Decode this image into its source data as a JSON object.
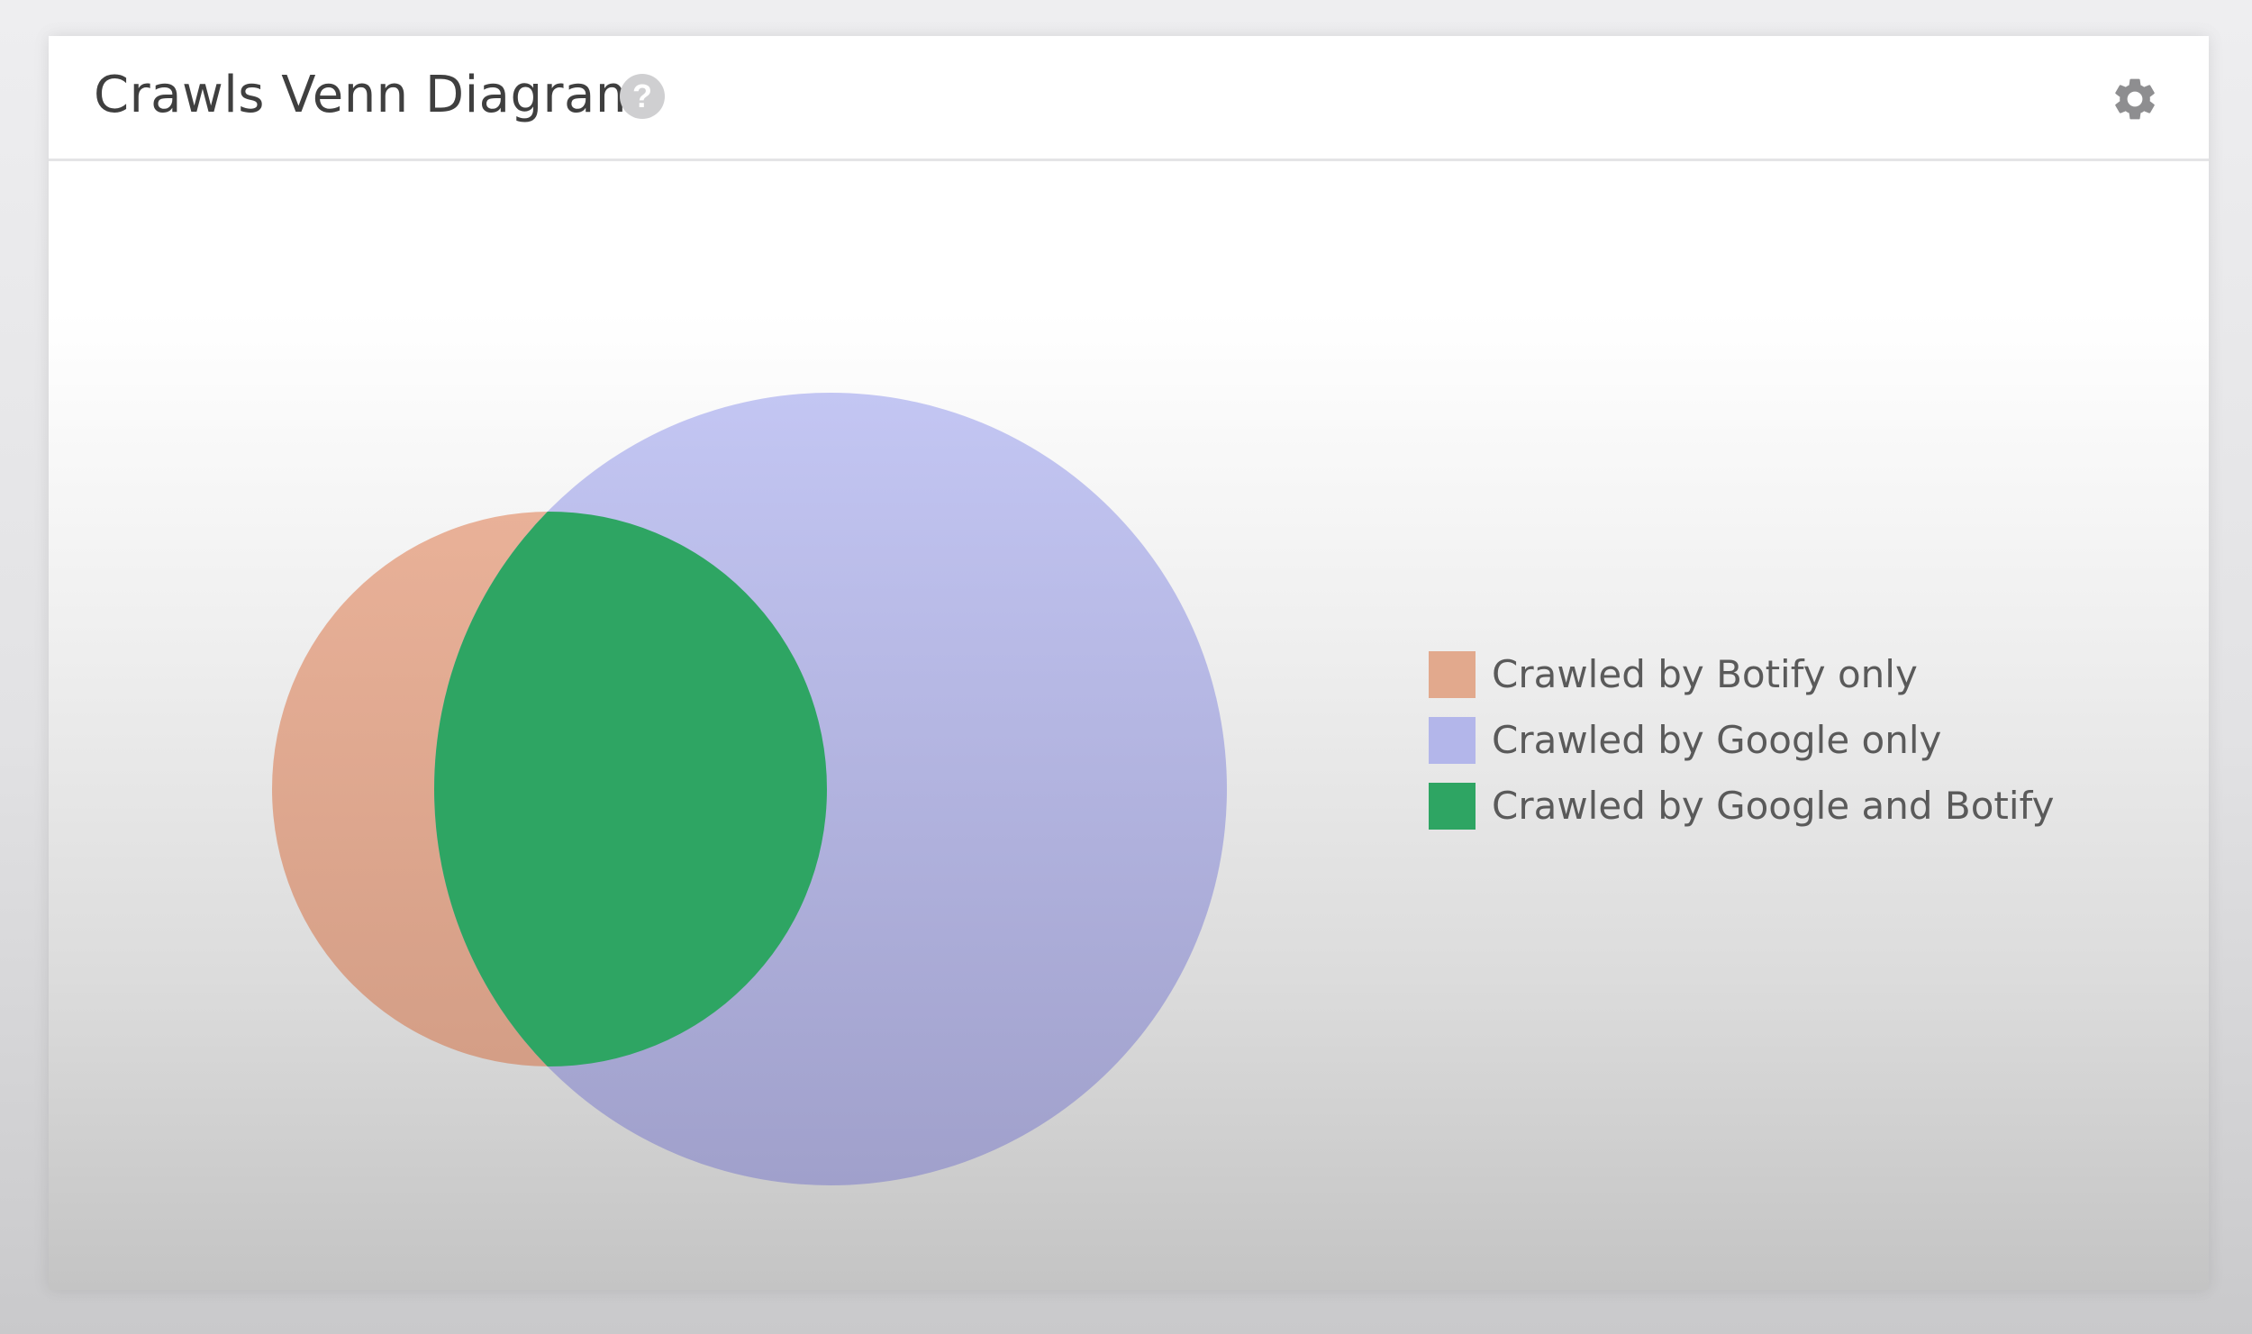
{
  "widget": {
    "title": "Crawls Venn Diagram",
    "help_icon": "help-icon",
    "settings_icon": "gear-icon"
  },
  "chart_data": {
    "type": "venn",
    "sets": [
      {
        "name": "Crawled by Botify only",
        "color": "#e2a98d"
      },
      {
        "name": "Crawled by Google only",
        "color": "#b3b6ea"
      },
      {
        "name": "Crawled by Google and Botify",
        "color": "#2ea563"
      }
    ],
    "legend_position": "right"
  },
  "legend": {
    "items": [
      {
        "label": "Crawled by Botify only",
        "color": "#e2a98d"
      },
      {
        "label": "Crawled by Google only",
        "color": "#b3b6ea"
      },
      {
        "label": "Crawled by Google and Botify",
        "color": "#2ea563"
      }
    ]
  }
}
